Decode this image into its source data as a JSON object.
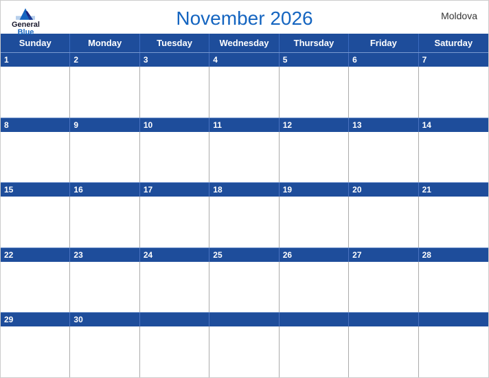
{
  "header": {
    "title": "November 2026",
    "country": "Moldova",
    "logo": {
      "line1": "General",
      "line2": "Blue"
    }
  },
  "days": {
    "headers": [
      "Sunday",
      "Monday",
      "Tuesday",
      "Wednesday",
      "Thursday",
      "Friday",
      "Saturday"
    ]
  },
  "weeks": [
    {
      "dates": [
        "1",
        "2",
        "3",
        "4",
        "5",
        "6",
        "7"
      ]
    },
    {
      "dates": [
        "8",
        "9",
        "10",
        "11",
        "12",
        "13",
        "14"
      ]
    },
    {
      "dates": [
        "15",
        "16",
        "17",
        "18",
        "19",
        "20",
        "21"
      ]
    },
    {
      "dates": [
        "22",
        "23",
        "24",
        "25",
        "26",
        "27",
        "28"
      ]
    },
    {
      "dates": [
        "29",
        "30",
        "",
        "",
        "",
        "",
        ""
      ]
    }
  ]
}
